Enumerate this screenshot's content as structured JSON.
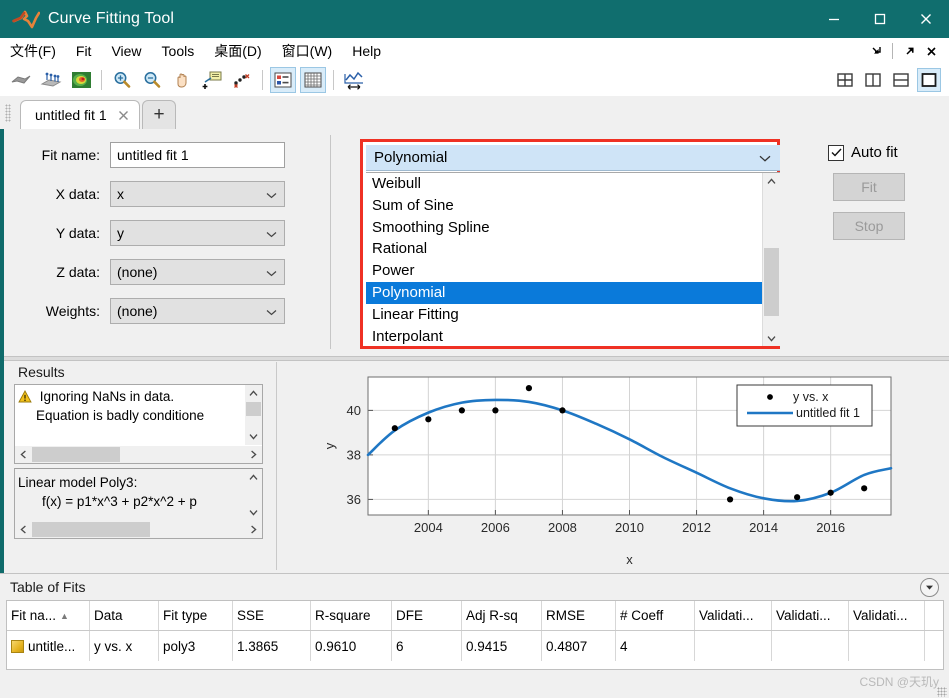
{
  "window": {
    "title": "Curve Fitting Tool",
    "logo_name": "matlab-logo",
    "minimize": "minimize-icon",
    "maximize": "maximize-icon",
    "close": "close-icon"
  },
  "menubar": {
    "items": [
      {
        "label": "文件(F)",
        "mnemonic": "F"
      },
      {
        "label": "Fit",
        "mnemonic": "i"
      },
      {
        "label": "View",
        "mnemonic": "V"
      },
      {
        "label": "Tools",
        "mnemonic": "T"
      },
      {
        "label": "桌面(D)",
        "mnemonic": "D"
      },
      {
        "label": "窗口(W)",
        "mnemonic": "W"
      },
      {
        "label": "Help",
        "mnemonic": "H"
      }
    ],
    "right_buttons": [
      "dock-arrow-icon",
      "undock-arrow-icon",
      "close-icon"
    ]
  },
  "toolbar": {
    "buttons": [
      "surface-plot-icon",
      "residuals-plot-icon",
      "contour-plot-icon",
      "zoom-in-icon",
      "zoom-out-icon",
      "pan-icon",
      "data-cursor-icon",
      "exclude-outliers-icon",
      "legend-toggle-icon",
      "grid-toggle-icon",
      "axes-limits-icon"
    ],
    "layout_buttons": [
      "layout-grid-icon",
      "layout-vertical-icon",
      "layout-horizontal-icon",
      "layout-single-icon"
    ],
    "active_layout": "layout-single-icon"
  },
  "tabs": {
    "items": [
      {
        "label": "untitled fit 1",
        "close": "close-icon"
      }
    ],
    "add_label": "+"
  },
  "fit_editor": {
    "fields": [
      {
        "label": "Fit name:",
        "value": "untitled fit 1",
        "type": "text"
      },
      {
        "label": "X data:",
        "value": "x",
        "type": "combo"
      },
      {
        "label": "Y data:",
        "value": "y",
        "type": "combo"
      },
      {
        "label": "Z data:",
        "value": "(none)",
        "type": "combo"
      },
      {
        "label": "Weights:",
        "value": "(none)",
        "type": "combo"
      }
    ],
    "model": {
      "selected": "Polynomial",
      "options": [
        "Interpolant",
        "Linear Fitting",
        "Polynomial",
        "Power",
        "Rational",
        "Smoothing Spline",
        "Sum of Sine",
        "Weibull"
      ],
      "highlight_color": "#ef3124",
      "selection_color": "#0a7ada"
    },
    "auto_fit": {
      "label": "Auto fit",
      "checked": true
    },
    "fit_button": "Fit",
    "stop_button": "Stop"
  },
  "results": {
    "title": "Results",
    "warning_icon": "warning-triangle-icon",
    "messages": [
      "Ignoring NaNs in data.",
      "Equation is badly conditione"
    ],
    "equation_lines": [
      "Linear model Poly3:",
      "f(x) = p1*x^3 + p2*x^2 + p"
    ]
  },
  "chart_data": {
    "type": "scatter",
    "title": "",
    "xlabel": "x",
    "ylabel": "y",
    "xlim": [
      2002.2,
      2017.8
    ],
    "ylim": [
      35.3,
      41.5
    ],
    "xticks": [
      2004,
      2006,
      2008,
      2010,
      2012,
      2014,
      2016
    ],
    "yticks": [
      36,
      38,
      40
    ],
    "grid": true,
    "legend_position": "top-right",
    "series": [
      {
        "name": "y vs. x",
        "type": "scatter",
        "marker": "circle",
        "color": "#000000",
        "x": [
          2003,
          2004,
          2005,
          2006,
          2007,
          2008,
          2013,
          2015,
          2016,
          2017
        ],
        "y": [
          39.2,
          39.6,
          40.0,
          40.0,
          41.0,
          40.0,
          36.0,
          36.1,
          36.3,
          36.5
        ]
      },
      {
        "name": "untitled fit 1",
        "type": "line",
        "color": "#1f77c4",
        "x": [
          2002.2,
          2003,
          2004,
          2005,
          2006,
          2007,
          2008,
          2009,
          2010,
          2011,
          2012,
          2013,
          2014,
          2015,
          2016,
          2017,
          2017.8
        ],
        "y": [
          38.0,
          39.1,
          39.9,
          40.35,
          40.47,
          40.38,
          40.0,
          39.4,
          38.7,
          37.9,
          37.2,
          36.5,
          36.05,
          35.93,
          36.3,
          37.1,
          37.4
        ]
      }
    ]
  },
  "table_of_fits": {
    "title": "Table of Fits",
    "collapse_icon": "collapse-down-icon",
    "columns": [
      "Fit na...",
      "Data",
      "Fit type",
      "SSE",
      "R-square",
      "DFE",
      "Adj R-sq",
      "RMSE",
      "# Coeff",
      "Validati...",
      "Validati...",
      "Validati..."
    ],
    "sorted_column": "Fit na...",
    "rows": [
      {
        "swatch": "#e6b422",
        "cells": [
          "untitle...",
          "y vs. x",
          "poly3",
          "1.3865",
          "0.9610",
          "6",
          "0.9415",
          "0.4807",
          "4",
          "",
          "",
          ""
        ]
      }
    ]
  },
  "watermark": "CSDN @天玑y"
}
